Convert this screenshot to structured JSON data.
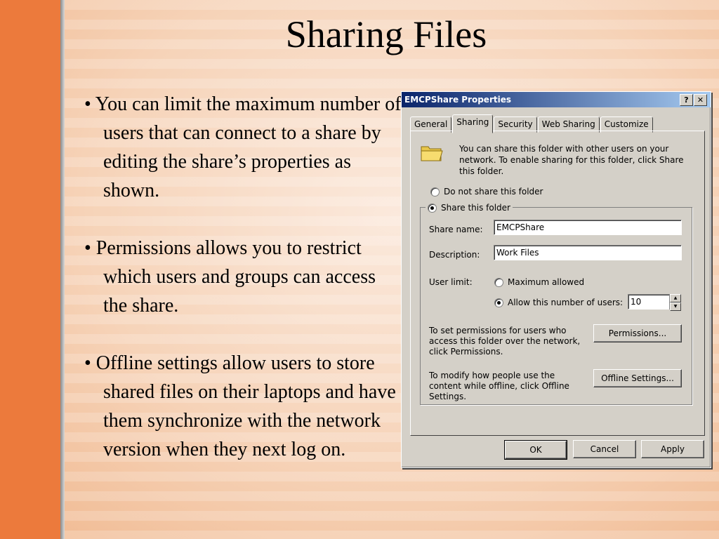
{
  "slide": {
    "title": "Sharing Files",
    "bullets": [
      "• You can limit the maximum number of users that can connect to a share by editing the share’s properties as shown.",
      "• Permissions allows you to restrict which users and groups can access the share.",
      "• Offline settings allow users to store shared files on their laptops and have them synchronize with the network version when they next log on."
    ]
  },
  "dialog": {
    "title": "EMCPShare Properties",
    "help_label": "?",
    "close_label": "✕",
    "tabs": [
      "General",
      "Sharing",
      "Security",
      "Web Sharing",
      "Customize"
    ],
    "intro_text": "You can share this folder with other users on your network.  To enable sharing for this folder, click Share this folder.",
    "radio_do_not_share": "Do not share this folder",
    "radio_share": "Share this folder",
    "share_name_label": "Share name:",
    "share_name_value": "EMCPShare",
    "description_label": "Description:",
    "description_value": "Work Files",
    "user_limit_label": "User limit:",
    "radio_max_allowed": "Maximum allowed",
    "radio_allow_number": "Allow this number of users:",
    "user_count": "10",
    "permissions_text": "To set permissions for users who access this folder over the network, click Permissions.",
    "permissions_button": "Permissions...",
    "offline_text": "To modify how people use the content while offline, click Offline Settings.",
    "offline_button": "Offline Settings...",
    "ok_button": "OK",
    "cancel_button": "Cancel",
    "apply_button": "Apply"
  },
  "colors": {
    "accent_bar": "#ec7a3c",
    "titlebar": "#0a246a",
    "dialog_face": "#d4d0c8"
  }
}
